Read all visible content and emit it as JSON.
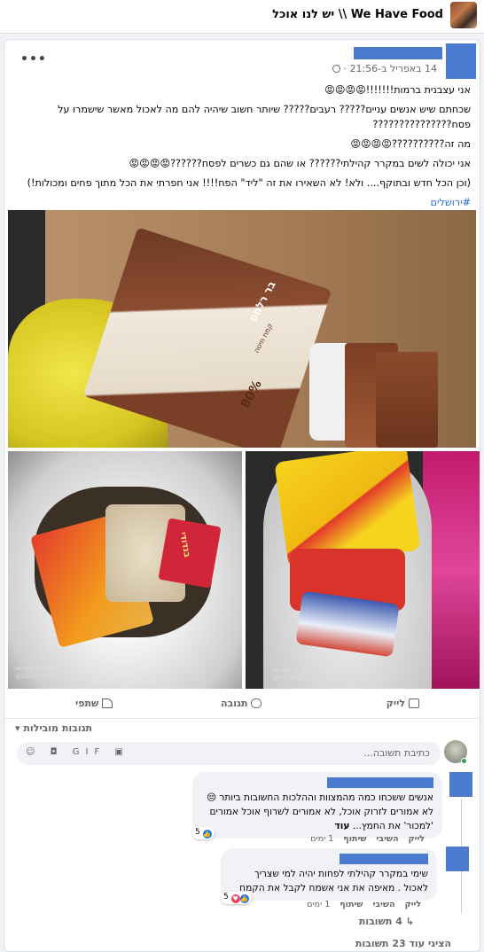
{
  "group": {
    "title": "יש לנו אוכל \\\\ We Have Food"
  },
  "post": {
    "time": "14 באפריל ב-21:56",
    "paragraphs": [
      "אני עצבנית ברמות!!!!!!!😡😡😡😡",
      "שכחתם שיש אנשים עניים????? רעבים????? שיותר חשוב שיהיה להם מה לאכול מאשר שישמרו על פסח???????????????",
      "מה זה??????????😡😡😡😡",
      "אני יכולה לשים במקרר קהילתי?????? או שהם גם כשרים לפסח??????😡😡😡😡",
      "(וכן הכל חדש ובתוקף.... ולא! לא השאירו את זה \"ליד\" הפח!!!! אני חפרתי את הכל מתוך פחים ומכולות!)"
    ],
    "hashtag": "#ירושלים",
    "photo_labels": {
      "top_brand": "בר רלחם",
      "top_product": "קמח חיטה",
      "top_percent": "80%",
      "left_brand": "בנדודי",
      "watermark_line1": "MI NOTE 10 LITE",
      "watermark_line2": "@CELESTINA"
    }
  },
  "actions": {
    "like": "לייק",
    "comment": "תגובה",
    "share": "שתפי"
  },
  "comments_section": {
    "sort_label": "תגובות מובילות",
    "input_placeholder": "כתיבת תשובה...",
    "input_icons": "☺ ◘ GIF ▣"
  },
  "comments": [
    {
      "text": "אנשים ששכחו כמה מהמצוות וההלכות החשובות ביותר 😔 לא אמורים לזרוק אוכל, לא אמורים לשרוף אוכל אמורים 'למכור' את החמץ...",
      "more": "עוד",
      "reaction_count": "5",
      "like": "לייק",
      "reply": "השיבי",
      "share": "שיתוף",
      "age": "1 ימים"
    },
    {
      "text": "שימי במקרר קהילתי לפחות יהיה למי שצריך לאכול . מאיפה את אני אשמח לקבל את הקמח",
      "reaction_count": "5",
      "like": "לייק",
      "reply": "השיבי",
      "share": "שיתוף",
      "age": "1 ימים"
    }
  ],
  "replies_label": "4 תשובות",
  "view_more_label": "הציגי עוד 23 תשובות",
  "colors": {
    "accent": "#216fdb",
    "redaction": "#4a7bd0",
    "like_blue": "#1877f2",
    "angry": "#e8590c"
  }
}
